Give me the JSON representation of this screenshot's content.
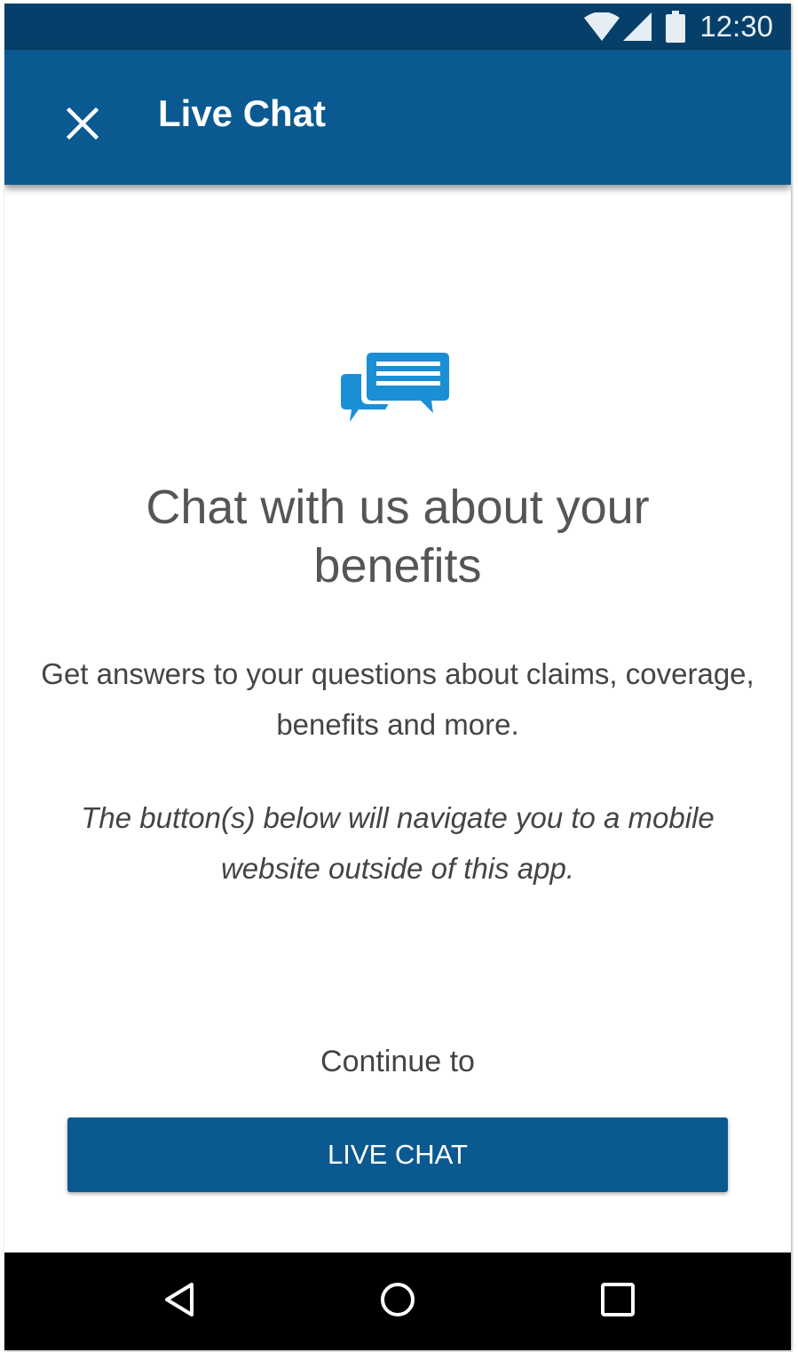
{
  "status_bar": {
    "time": "12:30",
    "icons": [
      "wifi-icon",
      "cellular-signal-icon",
      "battery-icon"
    ]
  },
  "app_bar": {
    "close_icon": "close-icon",
    "title": "Live Chat"
  },
  "main": {
    "illustration": "chat-bubbles-icon",
    "headline": "Chat with us about your benefits",
    "description": "Get answers to your questions about claims, coverage, benefits and more.",
    "disclaimer": "The button(s) below will navigate you to a mobile website outside of this app.",
    "continue_label": "Continue to",
    "live_chat_button": "LIVE CHAT"
  },
  "nav_bar": {
    "icons": [
      "back-icon",
      "home-icon",
      "recents-icon"
    ]
  },
  "colors": {
    "app_bar": "#0a5a91",
    "status_bar": "#063f69",
    "accent_icon": "#1a8fd6",
    "button": "#0a5a91"
  }
}
